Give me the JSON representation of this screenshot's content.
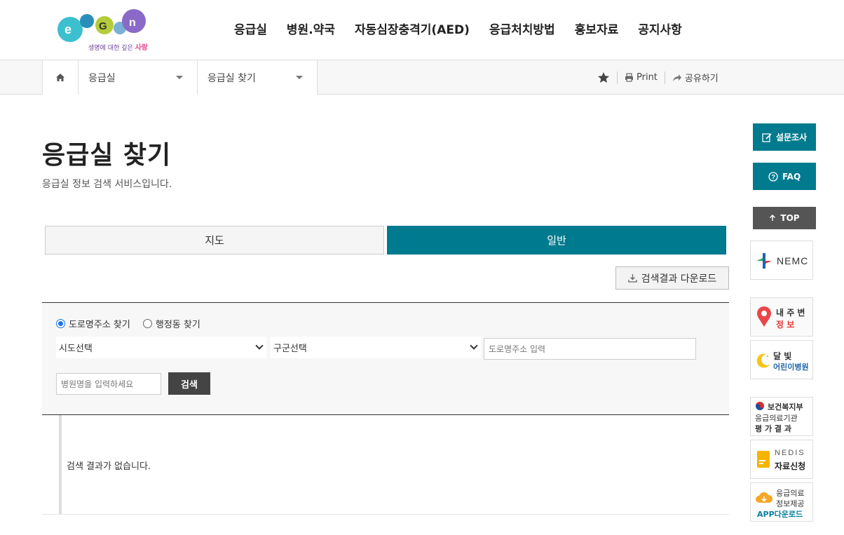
{
  "logo": {
    "tagline_main": "생명에 대한 깊은 ",
    "tagline_accent": "사랑"
  },
  "nav": {
    "items": [
      "응급실",
      "병원.약국",
      "자동심장충격기(AED)",
      "응급처치방법",
      "홍보자료",
      "공지사항"
    ]
  },
  "location": {
    "depth1": "응급실",
    "depth2": "응급실 찾기",
    "print_label": "Print",
    "share_label": "공유하기"
  },
  "page": {
    "title": "응급실 찾기",
    "description": "응급실 정보 검색 서비스입니다."
  },
  "tabs": {
    "map": "지도",
    "general": "일반"
  },
  "download_label": "검색결과 다운로드",
  "search": {
    "radio_road": "도로명주소 찾기",
    "radio_admin": "행정동 찾기",
    "sido_select": "시도선택",
    "gugun_select": "구군선택",
    "road_placeholder": "도로명주소 입력",
    "hospital_placeholder": "병원명을 입력하세요",
    "search_button": "검색"
  },
  "result": {
    "empty_message": "검색 결과가 없습니다."
  },
  "quick": {
    "survey": "설문조사",
    "faq": "FAQ",
    "top": "TOP",
    "nemc": "NEMC",
    "nearby_line1": "내 주 변",
    "nearby_line2": "정 보",
    "moon_line1": "달 빛",
    "moon_line2": "어린이병원",
    "eval_line1": "보건복지부",
    "eval_line2": "응급의료기관",
    "eval_line3": "평 가 결 과",
    "nedis_line1": "NEDIS",
    "nedis_line2": "자료신청",
    "app_line1": "응급의료",
    "app_line2": "정보제공",
    "app_line3": "APP다운로드"
  },
  "colors": {
    "teal": "#007a8e",
    "dark_button": "#444444"
  }
}
